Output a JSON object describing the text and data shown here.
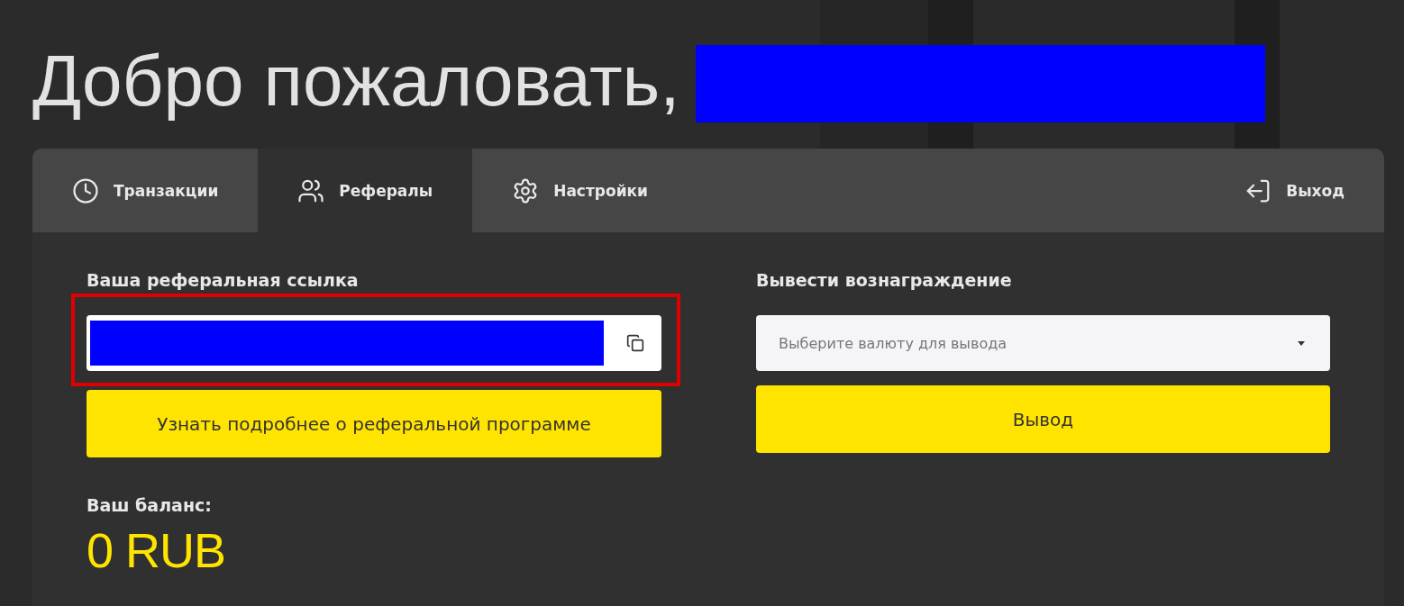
{
  "heading": "Добро пожаловать,",
  "tabs": [
    {
      "label": "Транзакции",
      "selected": false
    },
    {
      "label": "Рефералы",
      "selected": true
    },
    {
      "label": "Настройки",
      "selected": false
    }
  ],
  "logout": {
    "label": "Выход"
  },
  "referral": {
    "label": "Ваша реферальная ссылка",
    "highlighted": true,
    "button": "Узнать подробнее о реферальной программе"
  },
  "withdraw": {
    "label": "Вывести вознаграждение",
    "placeholder": "Выберите валюту для вывода",
    "button": "Вывод"
  },
  "balance": {
    "label": "Ваш баланс:",
    "value": "0 RUB"
  }
}
